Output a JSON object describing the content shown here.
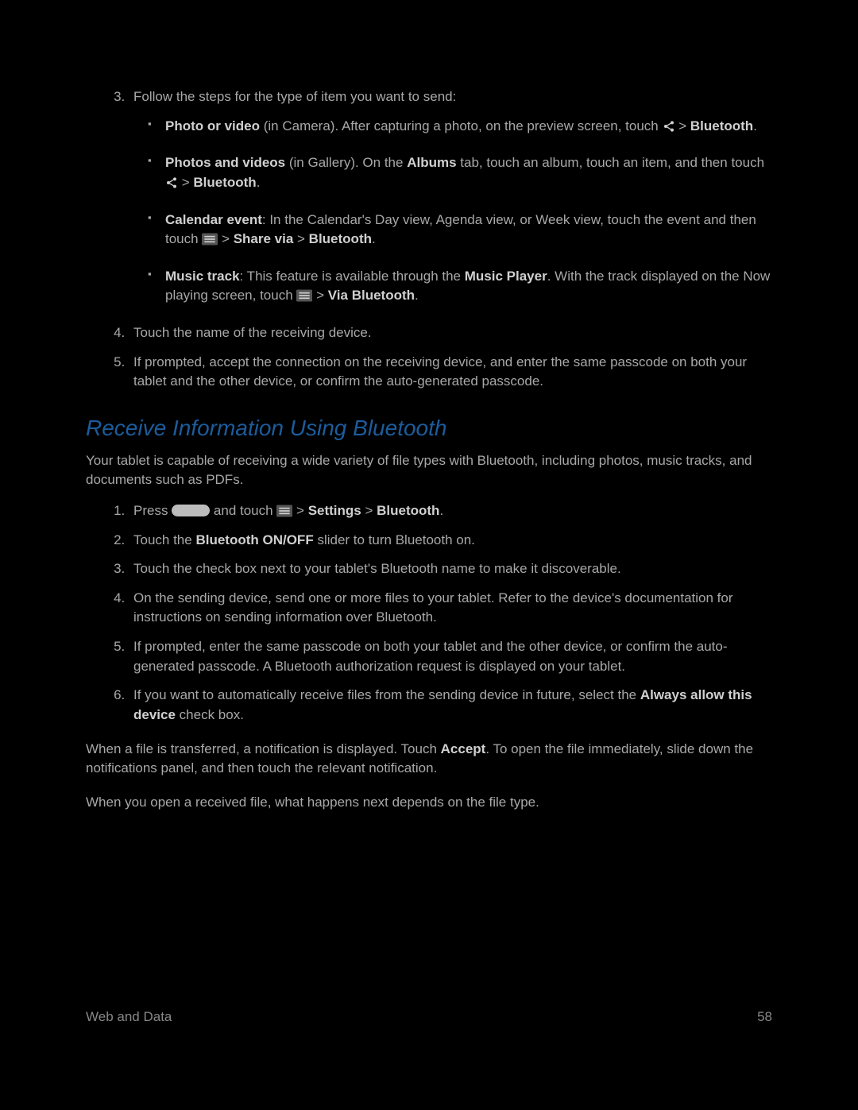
{
  "listA": {
    "item3_lead": "Follow the steps for the type of item you want to send:",
    "bullets": {
      "b1_a": "Photo or video",
      "b1_b": " (in Camera). After capturing a photo, on the preview screen, touch ",
      "b1_c": " > ",
      "b1_d": "Bluetooth",
      "b1_e": ".",
      "b2_a": "Photos and videos",
      "b2_b": " (in Gallery). On the ",
      "b2_c": "Albums",
      "b2_d": " tab, touch an album, touch an item, and then touch ",
      "b2_e": " > ",
      "b2_f": "Bluetooth",
      "b2_g": ".",
      "b3_a": "Calendar event",
      "b3_b": ": In the Calendar's Day view, Agenda view, or Week view, touch the event and then touch ",
      "b3_c": " > ",
      "b3_d": "Share via",
      "b3_e": " > ",
      "b3_f": "Bluetooth",
      "b3_g": ".",
      "b4_a": "Music track",
      "b4_b": ": This feature is available through the ",
      "b4_c": "Music Player",
      "b4_d": ". With the track displayed on the Now playing screen, touch ",
      "b4_e": " > ",
      "b4_f": "Via Bluetooth",
      "b4_g": "."
    },
    "item4": "Touch the name of the receiving device.",
    "item5": "If prompted, accept the connection on the receiving device, and enter the same passcode on both your tablet and the other device, or confirm the auto-generated passcode."
  },
  "section_heading": "Receive Information Using Bluetooth",
  "intro": "Your tablet is capable of receiving a wide variety of file types with Bluetooth, including photos, music tracks, and documents such as PDFs.",
  "listB": {
    "item1_a": "Press ",
    "item1_b": " and touch ",
    "item1_c": " > ",
    "item1_d": "Settings",
    "item1_e": " > ",
    "item1_f": "Bluetooth",
    "item1_g": ".",
    "item2_a": "Touch the ",
    "item2_b": "Bluetooth ON/OFF",
    "item2_c": " slider to turn Bluetooth on.",
    "item3": "Touch the check box next to your tablet's Bluetooth name to make it discoverable.",
    "item4": "On the sending device, send one or more files to your tablet. Refer to the device's documentation for instructions on sending information over Bluetooth.",
    "item5": "If prompted, enter the same passcode on both your tablet and the other device, or confirm the auto-generated passcode. A Bluetooth authorization request is displayed on your tablet.",
    "item6_a": "If you want to automatically receive files from the sending device in future, select the ",
    "item6_b": "Always allow this device",
    "item6_c": " check box."
  },
  "para1_a": "When a file is transferred, a notification is displayed. Touch ",
  "para1_b": "Accept",
  "para1_c": ". To open the file immediately, slide down the notifications panel, and then touch the relevant notification.",
  "para2": "When you open a received file, what happens next depends on the file type.",
  "footer_left": "Web and Data",
  "footer_right": "58"
}
